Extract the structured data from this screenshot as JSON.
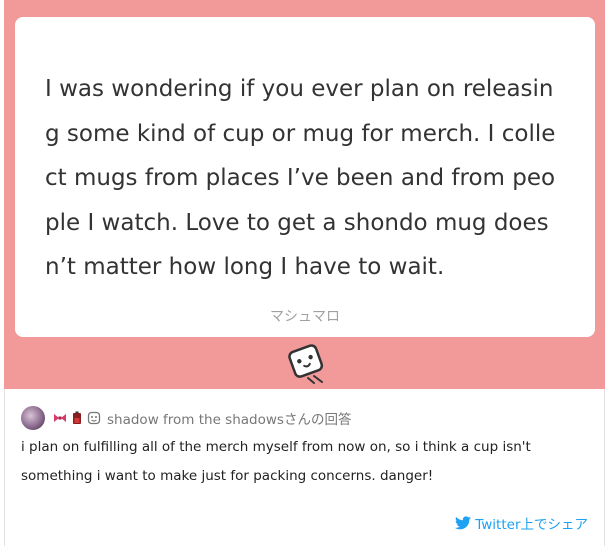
{
  "question": {
    "text": "I was wondering if you ever plan on releasing some kind of cup or mug for merch. I collect mugs from places I’ve been and from people I watch. Love to get a shondo mug doesn’t matter how long I have to wait.",
    "brand_label": "マシュマロ"
  },
  "answer": {
    "author_name": "shadow from the shadowsさんの回答",
    "text": "i plan on fulfilling all of the merch myself from now on, so i think a cup isn't something i want to make just for packing concerns. danger!",
    "share_label": "Twitter上でシェア"
  },
  "icons": {
    "mascot": "marshmallow-mascot-icon",
    "emoji_1": "ribbon-icon",
    "emoji_2": "battery-icon",
    "emoji_3": "face-icon",
    "share": "twitter-bird-icon"
  },
  "colors": {
    "pink_background": "#f29a9a",
    "twitter_blue": "#1da1f2",
    "text_dark": "#333333",
    "text_muted": "#a0a0a0"
  }
}
